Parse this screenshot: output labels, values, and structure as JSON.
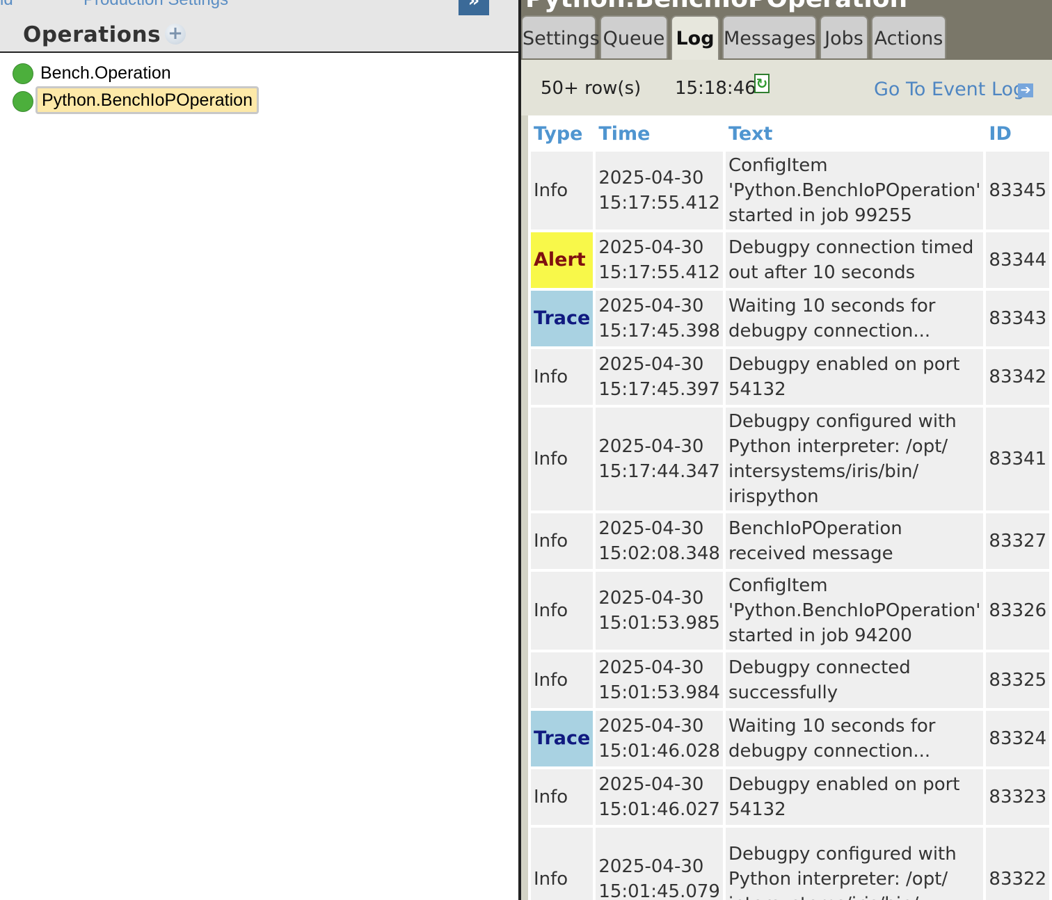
{
  "top_links": [
    "ld",
    "Production Settings"
  ],
  "collapse_label": "»",
  "operations": {
    "title": "Operations",
    "add_label": "+",
    "items": [
      {
        "label": "Bench.Operation",
        "status_color": "#4caf3c",
        "selected": false
      },
      {
        "label": "Python.BenchIoPOperation",
        "status_color": "#4caf3c",
        "selected": true
      }
    ]
  },
  "detail": {
    "title": "Python.BenchIoPOperation",
    "tabs": [
      {
        "label": "Settings",
        "active": false
      },
      {
        "label": "Queue",
        "active": false
      },
      {
        "label": "Log",
        "active": true
      },
      {
        "label": "Messages",
        "active": false
      },
      {
        "label": "Jobs",
        "active": false
      },
      {
        "label": "Actions",
        "active": false
      }
    ],
    "row_count": "50+ row(s)",
    "refresh_time": "15:18:46",
    "event_log_link": "Go To Event Log"
  },
  "log": {
    "columns": [
      "Type",
      "Time",
      "Text",
      "ID"
    ],
    "rows": [
      {
        "type": "Info",
        "date": "2025-04-30",
        "time": "15:17:55.412",
        "text": "ConfigItem 'Python.BenchIoPOperation' started in job 99255",
        "id": "83345"
      },
      {
        "type": "Alert",
        "date": "2025-04-30",
        "time": "15:17:55.412",
        "text": "Debugpy connection timed out after 10 seconds",
        "id": "83344"
      },
      {
        "type": "Trace",
        "date": "2025-04-30",
        "time": "15:17:45.398",
        "text": "Waiting 10 seconds for debugpy connection...",
        "id": "83343"
      },
      {
        "type": "Info",
        "date": "2025-04-30",
        "time": "15:17:45.397",
        "text": "Debugpy enabled on port 54132",
        "id": "83342"
      },
      {
        "type": "Info",
        "date": "2025-04-30",
        "time": "15:17:44.347",
        "text": "Debugpy configured with Python interpreter: /opt/ intersystems/iris/bin/ irispython",
        "id": "83341"
      },
      {
        "type": "Info",
        "date": "2025-04-30",
        "time": "15:02:08.348",
        "text": "BenchIoPOperation received message",
        "id": "83327"
      },
      {
        "type": "Info",
        "date": "2025-04-30",
        "time": "15:01:53.985",
        "text": "ConfigItem 'Python.BenchIoPOperation' started in job 94200",
        "id": "83326"
      },
      {
        "type": "Info",
        "date": "2025-04-30",
        "time": "15:01:53.984",
        "text": "Debugpy connected successfully",
        "id": "83325"
      },
      {
        "type": "Trace",
        "date": "2025-04-30",
        "time": "15:01:46.028",
        "text": "Waiting 10 seconds for debugpy connection...",
        "id": "83324"
      },
      {
        "type": "Info",
        "date": "2025-04-30",
        "time": "15:01:46.027",
        "text": "Debugpy enabled on port 54132",
        "id": "83323"
      },
      {
        "type": "Info",
        "date": "2025-04-30",
        "time": "15:01:45.079",
        "text": "Debugpy configured with Python interpreter: /opt/ intersystems/iris/bin/",
        "id": "83322"
      }
    ]
  },
  "colors": {
    "accent_link": "#4f86c2",
    "alert_bg": "#f8f84a",
    "trace_bg": "#a9d2e2",
    "status_ok": "#4caf3c"
  }
}
